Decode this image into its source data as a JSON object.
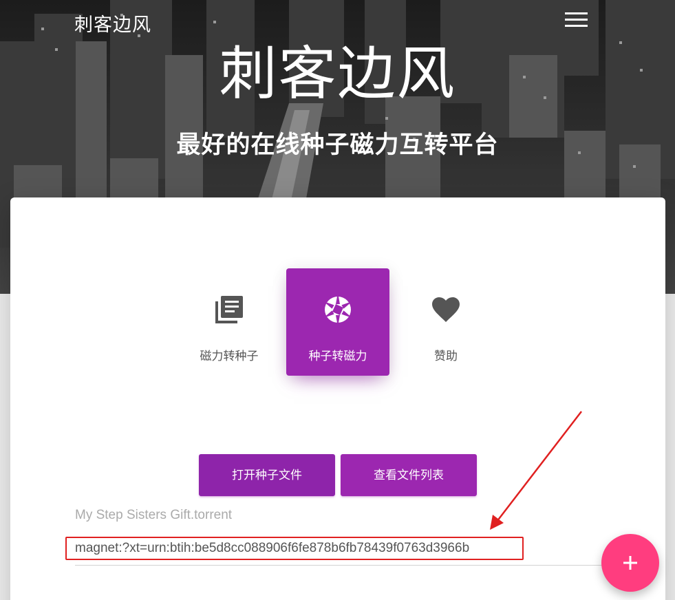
{
  "header": {
    "brand": "刺客边风",
    "menu_icon": "hamburger-menu-icon"
  },
  "hero": {
    "title": "刺客边风",
    "subtitle": "最好的在线种子磁力互转平台"
  },
  "tabs": [
    {
      "label": "磁力转种子",
      "icon": "library-books-icon",
      "active": false
    },
    {
      "label": "种子转磁力",
      "icon": "camera-aperture-icon",
      "active": true
    },
    {
      "label": "赞助",
      "icon": "heart-icon",
      "active": false
    }
  ],
  "buttons": {
    "open_torrent": "打开种子文件",
    "view_files": "查看文件列表"
  },
  "torrent": {
    "filename": "My Step Sisters Gift.torrent",
    "magnet": "magnet:?xt=urn:btih:be5d8cc088906f6fe878b6fb78439f0763d3966b"
  },
  "fab": {
    "icon": "plus-icon"
  },
  "colors": {
    "primary": "#9c27b0",
    "fab": "#ff3d7f",
    "highlight": "#e02020"
  }
}
